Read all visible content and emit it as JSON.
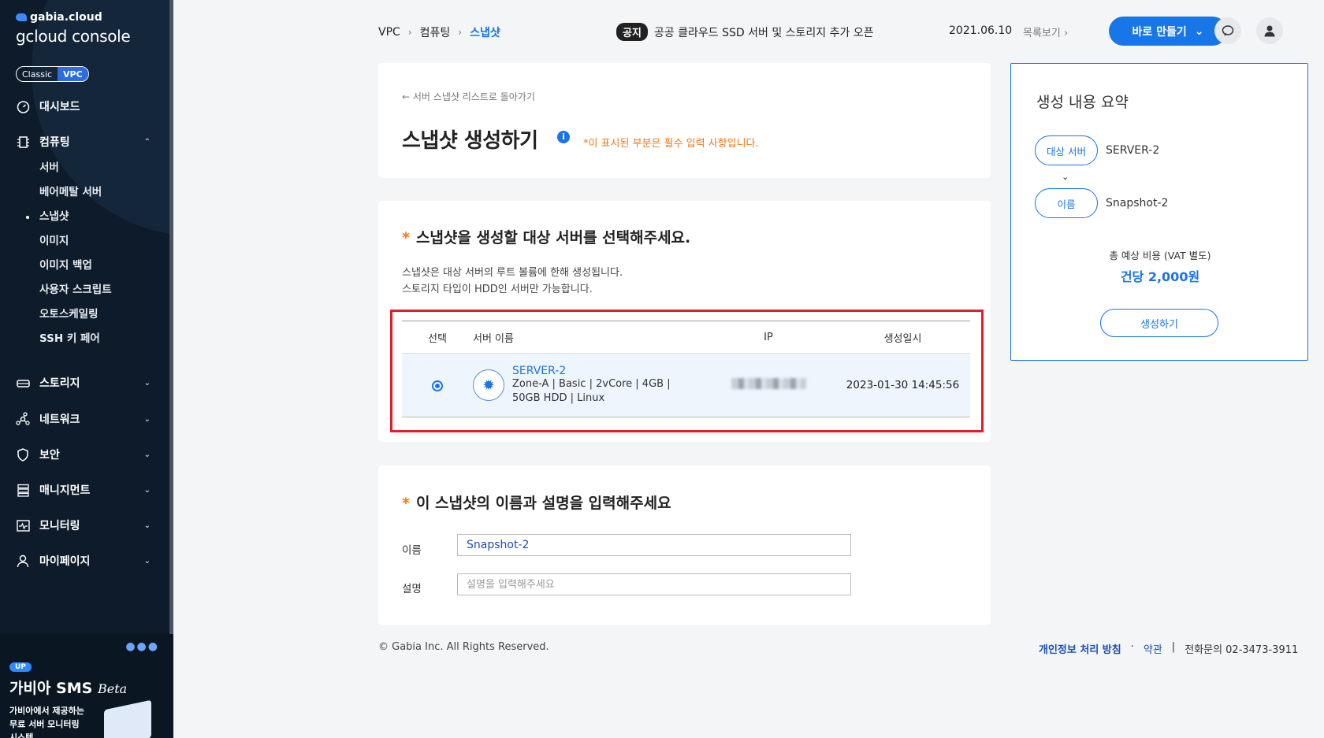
{
  "sidebar": {
    "brand": "gabia.cloud",
    "console": "gcloud console",
    "toggle": [
      "Classic",
      "VPC"
    ],
    "nav": {
      "dashboard": "대시보드",
      "computing": "컴퓨팅",
      "computing_sub": [
        "서버",
        "베어메탈 서버",
        "스냅샷",
        "이미지",
        "이미지 백업",
        "사용자 스크립트",
        "오토스케일링",
        "SSH 키 페어"
      ],
      "storage": "스토리지",
      "network": "네트워크",
      "security": "보안",
      "management": "매니지먼트",
      "monitoring": "모니터링",
      "mypage": "마이페이지"
    },
    "promo": {
      "badge": "UP",
      "title": "가비아 SMS",
      "title_suffix": "Beta",
      "desc_line1": "가비아에서 제공하는",
      "desc_line2": "무료 서버 모니터링",
      "desc_line3": "시스템"
    }
  },
  "header": {
    "breadcrumb": [
      "VPC",
      "컴퓨팅",
      "스냅샷"
    ],
    "notice_tag": "공지",
    "notice_text": "공공 클라우드 SSD 서버 및 스토리지 추가 오픈",
    "notice_date": "2021.06.10",
    "list_link": "목록보기",
    "create_button": "바로 만들기"
  },
  "intro": {
    "back_link": "서버 스냅샷 리스트로 돌아가기",
    "title": "스냅샷 생성하기",
    "required_note": "*이 표시된 부분은 필수 입력 사항입니다."
  },
  "server_section": {
    "title": "스냅샷을 생성할 대상 서버를 선택해주세요.",
    "hint1": "스냅샷은 대상 서버의 루트 볼륨에 한해 생성됩니다.",
    "hint2": "스토리지 타입이 HDD인 서버만 가능합니다.",
    "columns": [
      "선택",
      "서버 이름",
      "IP",
      "생성일시"
    ],
    "row": {
      "name": "SERVER-2",
      "spec_line1": "Zone-A  |  Basic  |  2vCore  |  4GB  |",
      "spec_line2": "50GB HDD  |  Linux",
      "created": "2023-01-30 14:45:56"
    }
  },
  "name_section": {
    "title": "이 스냅샷의 이름과 설명을 입력해주세요",
    "name_label": "이름",
    "name_value": "Snapshot-2",
    "desc_label": "설명",
    "desc_placeholder": "설명을 입력해주세요"
  },
  "summary": {
    "title": "생성 내용 요약",
    "target_pill": "대상 서버",
    "target_value": "SERVER-2",
    "name_pill": "이름",
    "name_value": "Snapshot-2",
    "cost_label": "총 예상 비용 (VAT 별도)",
    "cost_value": "건당 2,000원",
    "create_button": "생성하기"
  },
  "footer": {
    "copyright": "© Gabia Inc. All Rights Reserved.",
    "privacy": "개인정보 처리 방침",
    "terms": "약관",
    "phone": "전화문의  02-3473-3911"
  },
  "colors": {
    "accent": "#1976e6",
    "sidebar_bg": "#0d1b2a",
    "required": "#f07818",
    "highlight_box": "#e01f26"
  }
}
